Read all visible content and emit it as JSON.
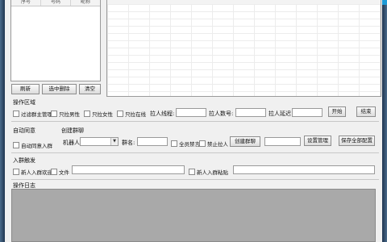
{
  "list_panel": {
    "columns": [
      "序号",
      "号码",
      "昵称"
    ]
  },
  "list_buttons": {
    "refresh": "刷新",
    "delete_selected": "选中删除",
    "clear": "清空"
  },
  "operation_area": {
    "title": "操作区域",
    "checkboxes": [
      "过滤群主管理",
      "只拉男性",
      "只拉女性",
      "只拉在线"
    ],
    "pull_thread_label": "拉人线程:",
    "pull_count_label": "拉人数号:",
    "pull_delay_label": "拉人延迟",
    "start_button": "开始",
    "stop_button": "结束"
  },
  "auto_accept": {
    "title": "自动同意",
    "checkbox": "自动同意入群"
  },
  "create_group": {
    "title": "创建群聊",
    "robot_label": "机器人:",
    "group_name_label": "群名:",
    "mute_all": "全员禁言",
    "no_pull": "禁止拉人",
    "create_button": "创建群聊",
    "set_admin_button": "设置管理",
    "save_config_button": "保存全部配置"
  },
  "join_trigger": {
    "title": "入群触发",
    "welcome": "新人入群欢迎",
    "file": "文件",
    "paste": "新人入群粘贴"
  },
  "log": {
    "title": "操作日志"
  },
  "colors": {
    "frame": "#1f3550",
    "accent": "#1d9bd7",
    "log_bg": "#a9a9a9"
  }
}
